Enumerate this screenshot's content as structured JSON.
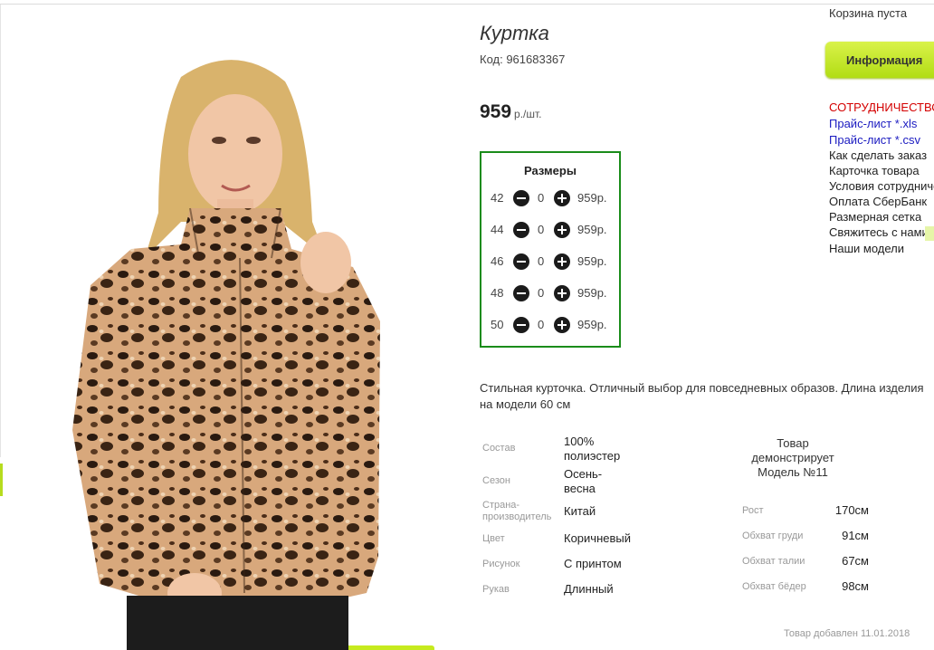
{
  "product": {
    "title": "Куртка",
    "code": "Код: 961683367",
    "price": "959",
    "price_unit": "р./шт."
  },
  "sizes": {
    "heading": "Размеры",
    "rows": [
      {
        "size": "42",
        "qty": "0",
        "price": "959р."
      },
      {
        "size": "44",
        "qty": "0",
        "price": "959р."
      },
      {
        "size": "46",
        "qty": "0",
        "price": "959р."
      },
      {
        "size": "48",
        "qty": "0",
        "price": "959р."
      },
      {
        "size": "50",
        "qty": "0",
        "price": "959р."
      }
    ]
  },
  "description": "Стильная курточка. Отличный выбор для повседневных образов. Длина изделия на модели 60 см",
  "properties": [
    {
      "label": "Состав",
      "value": "100% полиэстер"
    },
    {
      "label": "Сезон",
      "value": "Осень-весна"
    },
    {
      "label": "Страна-производитель",
      "value": "Китай"
    },
    {
      "label": "Цвет",
      "value": "Коричневый"
    },
    {
      "label": "Рисунок",
      "value": "С принтом"
    },
    {
      "label": "Рукав",
      "value": "Длинный"
    }
  ],
  "model": {
    "heading": "Товар демонстрирует Модель №11",
    "params": [
      {
        "label": "Рост",
        "value": "170см"
      },
      {
        "label": "Обхват груди",
        "value": "91см"
      },
      {
        "label": "Обхват талии",
        "value": "67см"
      },
      {
        "label": "Обхват бёдер",
        "value": "98см"
      }
    ]
  },
  "added": "Товар добавлен 11.01.2018",
  "sidebar": {
    "cart": "Корзина пуста",
    "info_button": "Информация",
    "links": [
      {
        "label": "СОТРУДНИЧЕСТВО",
        "style": "red"
      },
      {
        "label": "Прайс-лист *.xls",
        "style": "blue"
      },
      {
        "label": "Прайс-лист *.csv",
        "style": "blue"
      },
      {
        "label": "Как сделать заказ",
        "style": "dark"
      },
      {
        "label": "Карточка товара",
        "style": "dark"
      },
      {
        "label": "Условия сотрудничества",
        "style": "dark"
      },
      {
        "label": "Оплата СберБанк",
        "style": "dark"
      },
      {
        "label": "Размерная сетка",
        "style": "dark"
      },
      {
        "label": "Свяжитесь с нами",
        "style": "dark"
      },
      {
        "label": "Наши модели",
        "style": "dark"
      }
    ]
  },
  "colors": {
    "accent_green": "#b2dd14",
    "sizes_border": "#1a8c1a",
    "link_red": "#d40000",
    "link_blue": "#1a1ac0"
  }
}
